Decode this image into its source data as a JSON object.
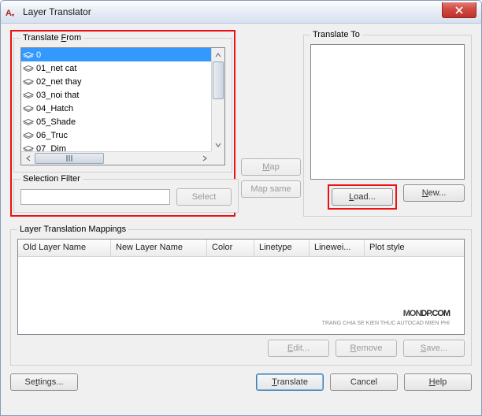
{
  "window": {
    "title": "Layer Translator",
    "app_icon_text": "A"
  },
  "translate_from": {
    "legend": "Translate From",
    "legend_uchar": "F",
    "items": [
      "0",
      "01_net cat",
      "02_net thay",
      "03_noi that",
      "04_Hatch",
      "05_Shade",
      "06_Truc",
      "07_Dim"
    ]
  },
  "translate_to": {
    "legend": "Translate To",
    "load_label": "Load...",
    "new_label": "New..."
  },
  "mid_buttons": {
    "map": "Map",
    "map_same": "Map same"
  },
  "selection_filter": {
    "legend": "Selection Filter",
    "select_label": "Select",
    "value": ""
  },
  "mappings": {
    "legend": "Layer Translation Mappings",
    "columns": [
      "Old Layer Name",
      "New Layer Name",
      "Color",
      "Linetype",
      "Linewei...",
      "Plot style"
    ],
    "edit_label": "Edit...",
    "remove_label": "Remove",
    "save_label": "Save..."
  },
  "bottom": {
    "settings": "Settings...",
    "translate": "Translate",
    "cancel": "Cancel",
    "help": "Help"
  },
  "watermark": {
    "main_prefix": "MON",
    "main_mid": "DP",
    "main_suffix": ".",
    "main_end": "COM",
    "sub": "TRANG CHIA SE KIEN THUC AUTOCAD MIEN PHI"
  }
}
